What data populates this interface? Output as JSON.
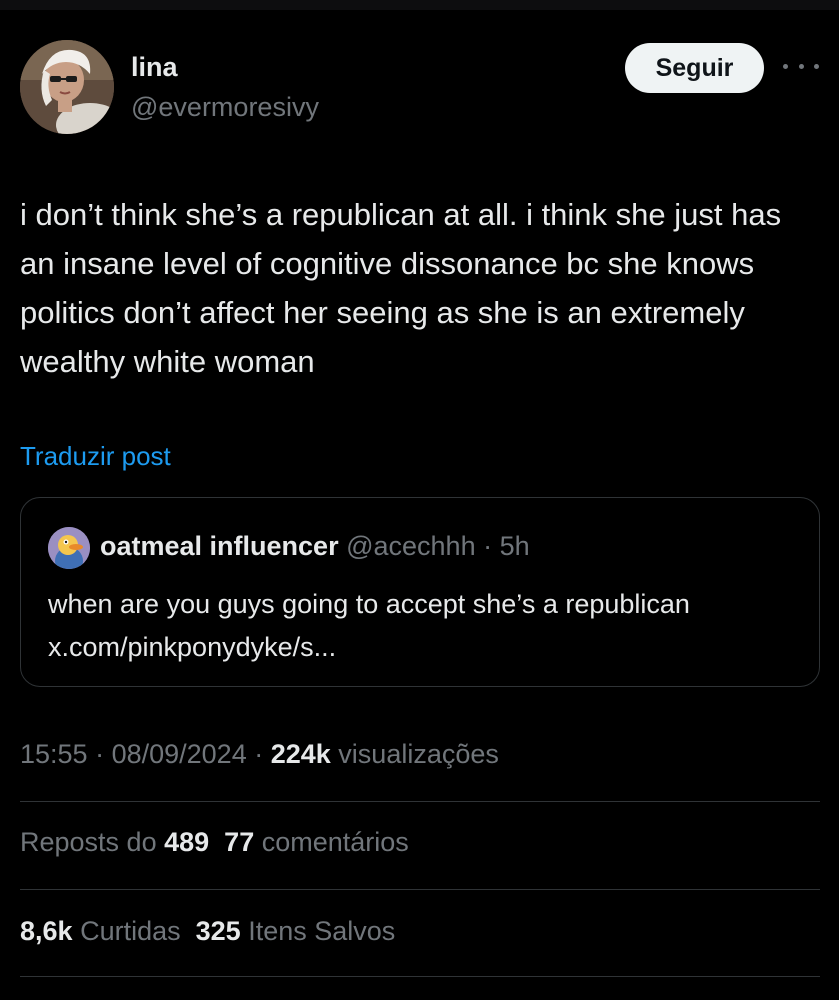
{
  "author": {
    "name": "lina",
    "handle": "@evermoresivy",
    "follow_label": "Seguir"
  },
  "tweet": {
    "text": "i don’t think she’s a republican at all. i think she just has an insane level of cognitive dissonance bc she knows politics don’t affect her seeing as she is an extremely wealthy white woman",
    "translate_label": "Traduzir post"
  },
  "quote": {
    "name": "oatmeal influencer",
    "handle": "@acechhh",
    "separator": " · ",
    "time": "5h",
    "text": "when are you guys going to accept she’s a republican x.com/pinkponydyke/s..."
  },
  "meta": {
    "time": "15:55",
    "sep1": " · ",
    "date": "08/09/2024",
    "sep2": " · ",
    "views_count": "224k",
    "views_label": " visualizações"
  },
  "stats": {
    "reposts_label": "Reposts do ",
    "reposts_count": "489",
    "comments_count": "77",
    "comments_label": " comentários",
    "likes_count": "8,6k",
    "likes_label": " Curtidas",
    "saves_count": "325",
    "saves_label": " Itens Salvos"
  },
  "colors": {
    "background": "#000000",
    "text": "#e7e9ea",
    "secondary": "#71767b",
    "link": "#1d9bf0",
    "border": "#2f3336"
  }
}
